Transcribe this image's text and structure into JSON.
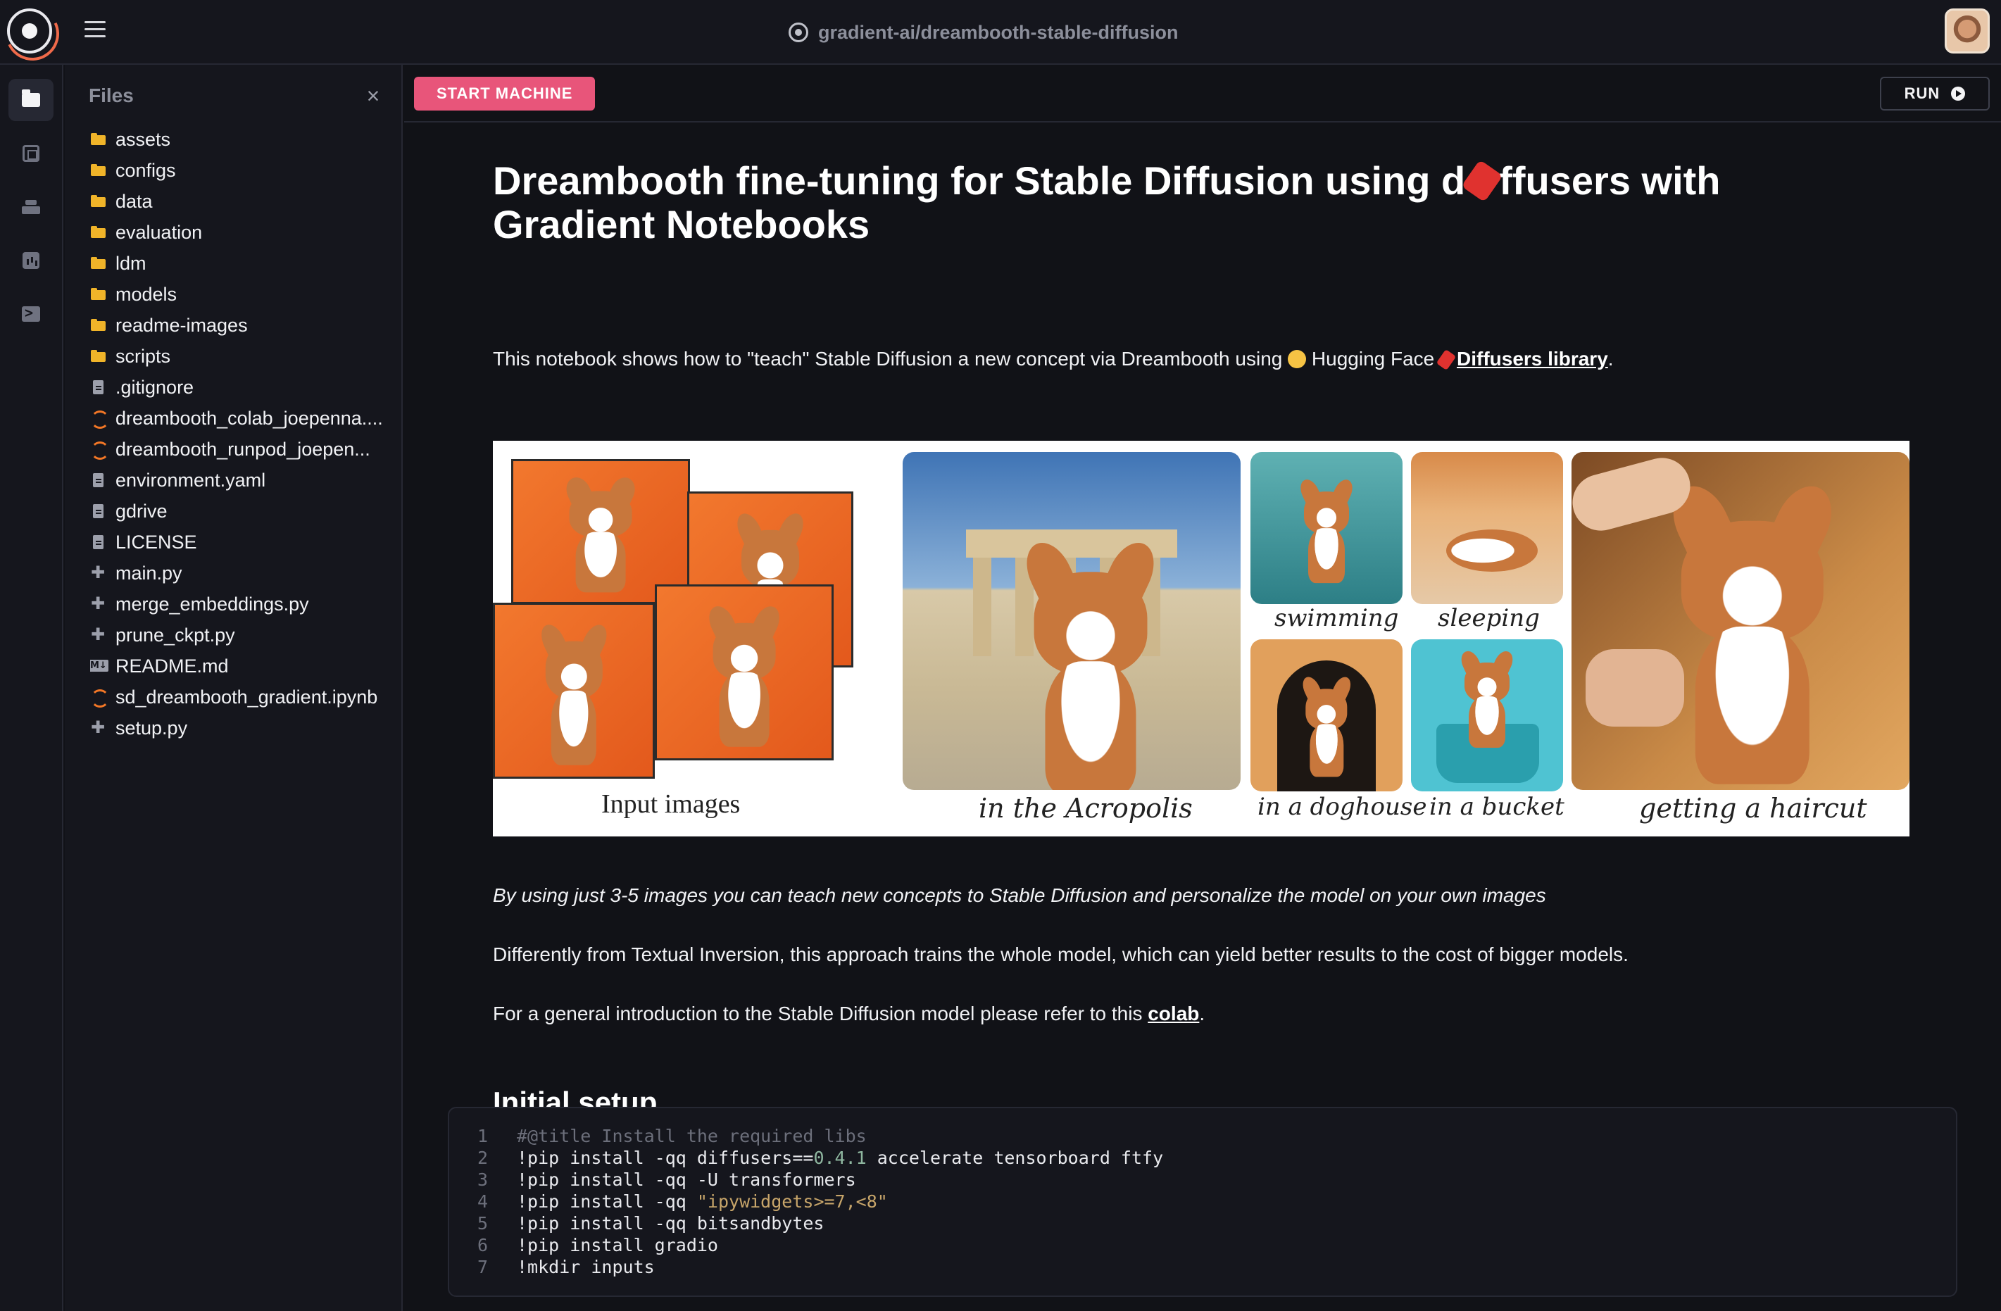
{
  "header": {
    "repo": "gradient-ai/dreambooth-stable-diffusion"
  },
  "files_panel": {
    "title": "Files",
    "close_glyph": "×",
    "items": [
      {
        "name": "assets",
        "type": "folder"
      },
      {
        "name": "configs",
        "type": "folder"
      },
      {
        "name": "data",
        "type": "folder"
      },
      {
        "name": "evaluation",
        "type": "folder"
      },
      {
        "name": "ldm",
        "type": "folder"
      },
      {
        "name": "models",
        "type": "folder"
      },
      {
        "name": "readme-images",
        "type": "folder"
      },
      {
        "name": "scripts",
        "type": "folder"
      },
      {
        "name": ".gitignore",
        "type": "file"
      },
      {
        "name": "dreambooth_colab_joepenna....",
        "type": "notebook"
      },
      {
        "name": "dreambooth_runpod_joepen...",
        "type": "notebook"
      },
      {
        "name": "environment.yaml",
        "type": "file"
      },
      {
        "name": "gdrive",
        "type": "file"
      },
      {
        "name": "LICENSE",
        "type": "file"
      },
      {
        "name": "main.py",
        "type": "python"
      },
      {
        "name": "merge_embeddings.py",
        "type": "python"
      },
      {
        "name": "prune_ckpt.py",
        "type": "python"
      },
      {
        "name": "README.md",
        "type": "markdown"
      },
      {
        "name": "sd_dreambooth_gradient.ipynb",
        "type": "notebook"
      },
      {
        "name": "setup.py",
        "type": "python"
      }
    ]
  },
  "toolbar": {
    "start_label": "START MACHINE",
    "run_label": "RUN"
  },
  "notebook": {
    "title_part1": "Dreambooth fine-tuning for Stable Diffusion using d",
    "title_part2": "ffusers with",
    "title_line2": "Gradient Notebooks",
    "intro_text": "This notebook shows how to \"teach\" Stable Diffusion a new concept via Dreambooth using ",
    "intro_mid": " Hugging Face ",
    "intro_link": "Diffusers library",
    "intro_end": ".",
    "figure_captions": {
      "input": "Input images",
      "acropolis": "in the Acropolis",
      "swimming": "swimming",
      "sleeping": "sleeping",
      "doghouse": "in a doghouse",
      "bucket": "in a bucket",
      "haircut": "getting a haircut"
    },
    "emphasis": "By using just 3-5 images you can teach new concepts to Stable Diffusion and personalize the model on your own images",
    "para2": "Differently from Textual Inversion, this approach trains the whole model, which can yield better results to the cost of bigger models.",
    "para3_pre": "For a general introduction to the Stable Diffusion model please refer to this ",
    "para3_link": "colab",
    "para3_end": ".",
    "section_title": "Initial setup"
  },
  "code_cell": {
    "lines": [
      {
        "n": "1",
        "parts": [
          {
            "t": "#@title Install the required libs",
            "c": "comment"
          }
        ]
      },
      {
        "n": "2",
        "parts": [
          {
            "t": "!pip install -qq diffusers==",
            "c": ""
          },
          {
            "t": "0.4.1",
            "c": "num"
          },
          {
            "t": " accelerate tensorboard ftfy",
            "c": ""
          }
        ]
      },
      {
        "n": "3",
        "parts": [
          {
            "t": "!pip install -qq -U transformers",
            "c": ""
          }
        ]
      },
      {
        "n": "4",
        "parts": [
          {
            "t": "!pip install -qq ",
            "c": ""
          },
          {
            "t": "\"ipywidgets>=7,<8\"",
            "c": "str"
          }
        ]
      },
      {
        "n": "5",
        "parts": [
          {
            "t": "!pip install -qq bitsandbytes",
            "c": ""
          }
        ]
      },
      {
        "n": "6",
        "parts": [
          {
            "t": "!pip install gradio",
            "c": ""
          }
        ]
      },
      {
        "n": "7",
        "parts": [
          {
            "t": "!mkdir inputs",
            "c": ""
          }
        ]
      }
    ]
  }
}
